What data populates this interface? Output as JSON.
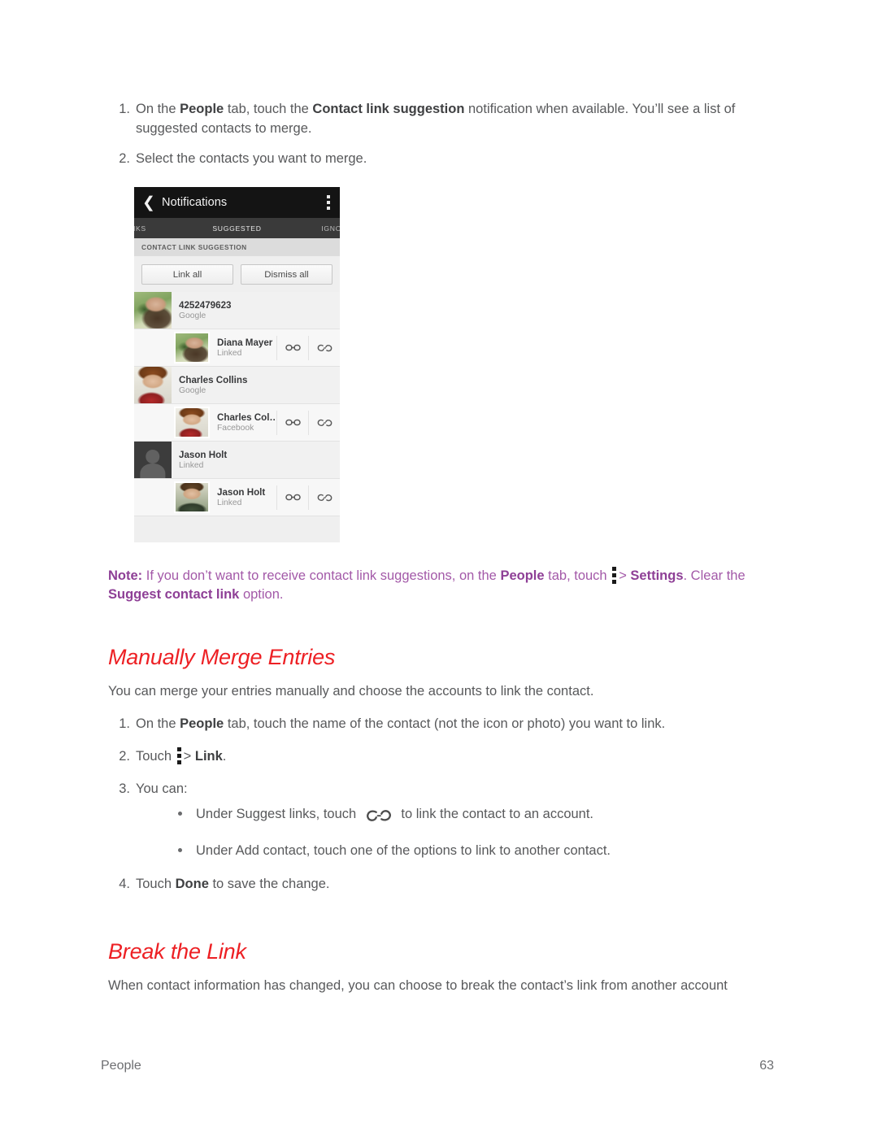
{
  "page": {
    "footer_section": "People",
    "footer_page_number": "63",
    "accent_heading_color": "#ed2024",
    "note_color": "#a359a8",
    "body_color": "#58595b"
  },
  "steps_top": [
    {
      "num": "1.",
      "parts": [
        {
          "t": "On the ",
          "b": false
        },
        {
          "t": "People",
          "b": true
        },
        {
          "t": " tab, touch the ",
          "b": false
        },
        {
          "t": "Contact link suggestion",
          "b": true
        },
        {
          "t": " notification when available. You’ll see a list of suggested contacts to merge.",
          "b": false
        }
      ]
    },
    {
      "num": "2.",
      "parts": [
        {
          "t": "Select the contacts you want to merge.",
          "b": false
        }
      ]
    }
  ],
  "screenshot": {
    "actionbar": {
      "back_icon": "chevron-left-icon",
      "title": "Notifications",
      "overflow_icon": "overflow-menu-icon"
    },
    "tabs": [
      {
        "label": "INKS",
        "selected": false
      },
      {
        "label": "SUGGESTED",
        "selected": true
      },
      {
        "label": "IGNOR",
        "selected": false
      }
    ],
    "section_header": "CONTACT LINK SUGGESTION",
    "buttons": [
      {
        "label": "Link all"
      },
      {
        "label": "Dismiss all"
      }
    ],
    "rows": [
      {
        "type": "parent",
        "name": "4252479623",
        "source": "Google",
        "avatar": "ph-diana",
        "actions": []
      },
      {
        "type": "child",
        "name": "Diana Mayer",
        "source": "Linked",
        "avatar": "ph-diana",
        "actions": [
          "link-icon",
          "break-link-icon"
        ]
      },
      {
        "type": "parent",
        "name": "Charles Collins",
        "source": "Google",
        "avatar": "ph-charles",
        "actions": []
      },
      {
        "type": "child",
        "name": "Charles Col…",
        "source": "Facebook",
        "avatar": "ph-charles",
        "actions": [
          "link-icon",
          "break-link-icon"
        ]
      },
      {
        "type": "parent",
        "name": "Jason Holt",
        "source": "Linked",
        "avatar": "ph-placeholder",
        "actions": []
      },
      {
        "type": "child",
        "name": "Jason Holt",
        "source": "Linked",
        "avatar": "ph-jason",
        "actions": [
          "link-icon",
          "break-link-icon"
        ]
      }
    ]
  },
  "note": {
    "label": "Note:",
    "parts": [
      {
        "t": " If you don’t want to receive contact link suggestions, on the ",
        "b": false
      },
      {
        "t": "People",
        "b": true
      },
      {
        "t": " tab, touch ",
        "b": false
      },
      {
        "t": "__DOTS__",
        "b": false
      },
      {
        "t": "> ",
        "b": false
      },
      {
        "t": "Settings",
        "b": true
      },
      {
        "t": ". Clear the ",
        "b": false
      },
      {
        "t": "Suggest contact link",
        "b": true
      },
      {
        "t": " option.",
        "b": false
      }
    ]
  },
  "manual_merge": {
    "heading": "Manually Merge Entries",
    "intro": "You can merge your entries manually and choose the accounts to link the contact.",
    "steps": [
      {
        "num": "1.",
        "parts": [
          {
            "t": "On the ",
            "b": false
          },
          {
            "t": "People",
            "b": true
          },
          {
            "t": " tab, touch the name of the contact (not the icon or photo) you want to link.",
            "b": false
          }
        ]
      },
      {
        "num": "2.",
        "parts": [
          {
            "t": "Touch ",
            "b": false
          },
          {
            "t": "__DOTS__",
            "b": false
          },
          {
            "t": "> ",
            "b": false
          },
          {
            "t": "Link",
            "b": true
          },
          {
            "t": ".",
            "b": false
          }
        ]
      },
      {
        "num": "3.",
        "parts": [
          {
            "t": "You can:",
            "b": false
          }
        ],
        "bullets": [
          {
            "parts": [
              {
                "t": "Under Suggest links, touch ",
                "b": false
              },
              {
                "t": "__BROKENLINK__",
                "b": false
              },
              {
                "t": " to link the contact to an account.",
                "b": false
              }
            ]
          },
          {
            "parts": [
              {
                "t": "Under Add contact, touch one of the options to link to another contact.",
                "b": false
              }
            ]
          }
        ]
      },
      {
        "num": "4.",
        "parts": [
          {
            "t": "Touch ",
            "b": false
          },
          {
            "t": "Done",
            "b": true
          },
          {
            "t": " to save the change.",
            "b": false
          }
        ]
      }
    ]
  },
  "break_link": {
    "heading": "Break the Link",
    "intro": "When contact information has changed, you can choose to break the contact’s link from another account"
  }
}
